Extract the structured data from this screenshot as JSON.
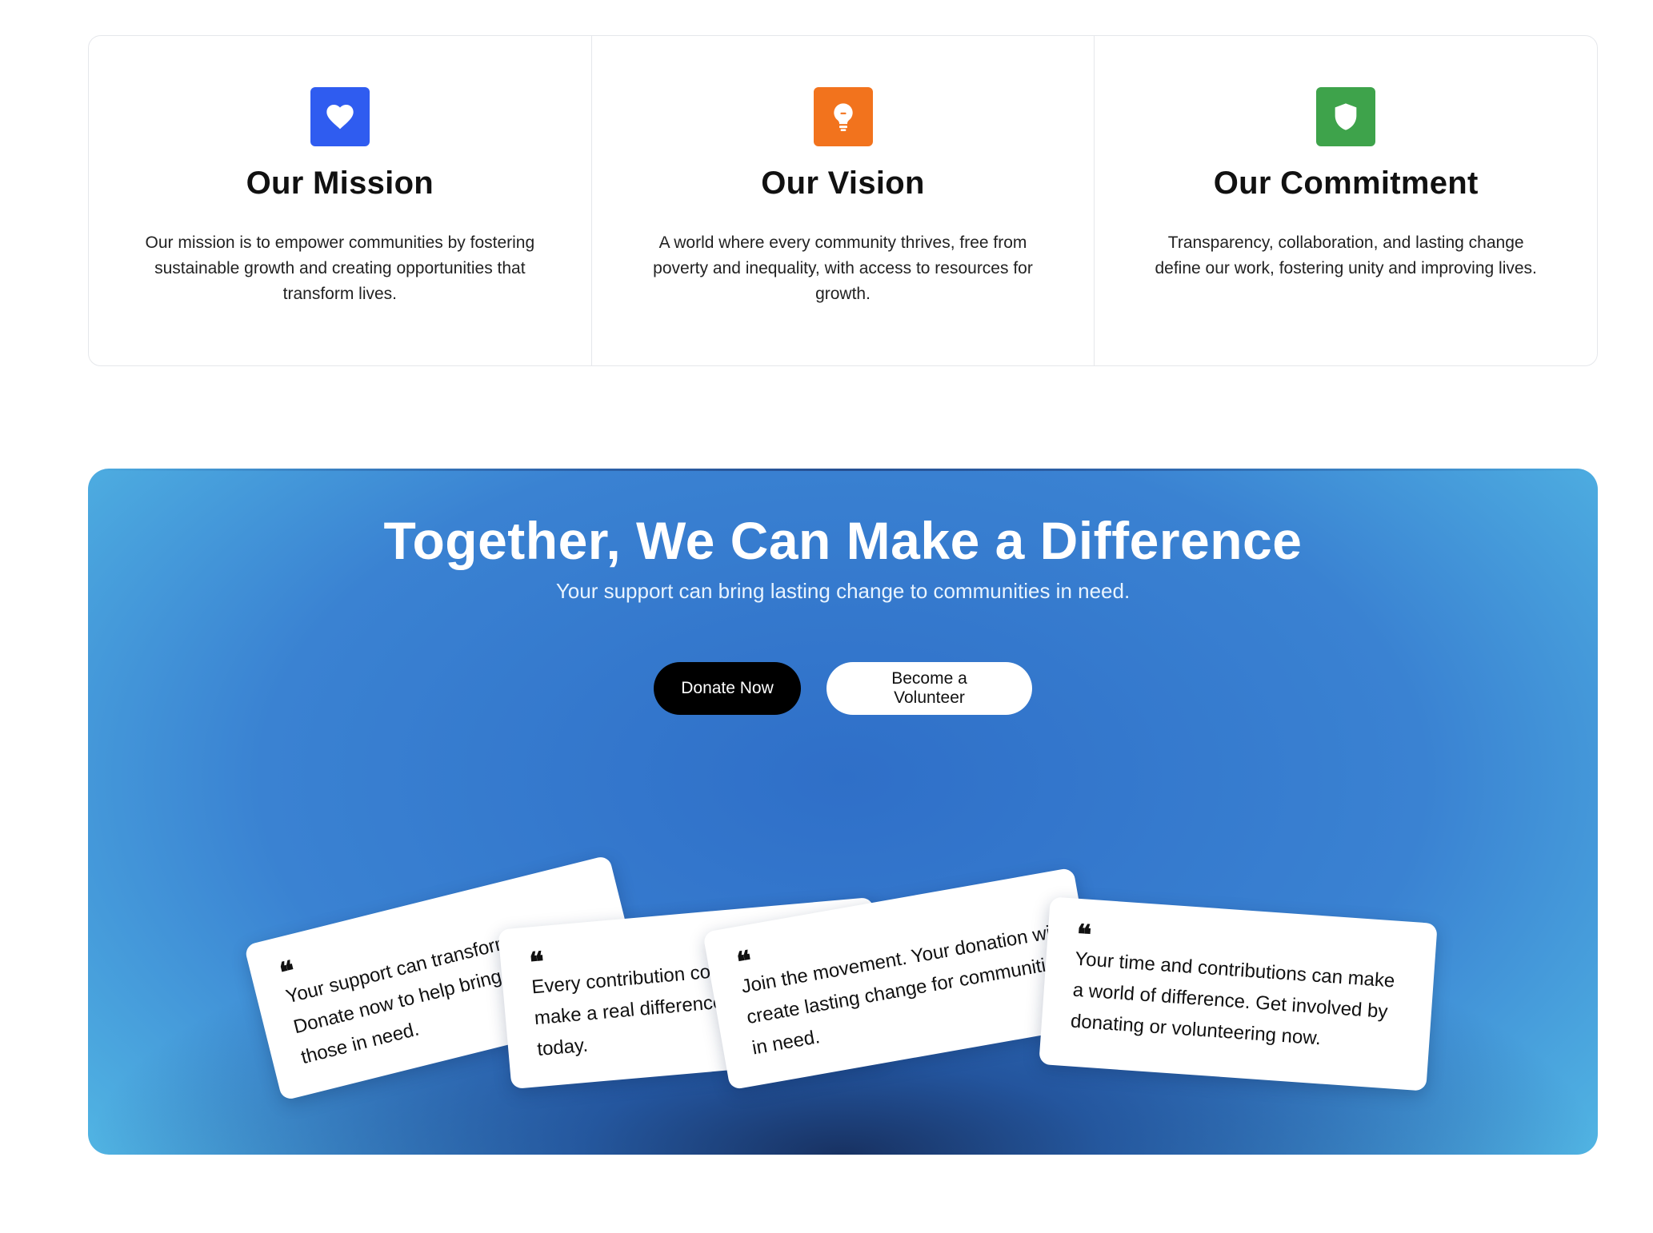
{
  "values": [
    {
      "title": "Our Mission",
      "text": "Our mission is to empower communities by fostering sustainable growth and creating opportunities that transform lives.",
      "icon": "heart-icon",
      "color": "#2f5cf0"
    },
    {
      "title": "Our Vision",
      "text": "A world where every community thrives, free from poverty and inequality, with access to resources for growth.",
      "icon": "lightbulb-icon",
      "color": "#f2731d"
    },
    {
      "title": "Our Commitment",
      "text": "Transparency, collaboration, and lasting change define our work, fostering unity and improving lives.",
      "icon": "shield-icon",
      "color": "#3ea34b"
    }
  ],
  "cta": {
    "title": "Together, We Can Make a Difference",
    "subtitle": "Your support can bring lasting change to communities in need.",
    "donate_label": "Donate Now",
    "volunteer_label": "Become a Volunteer"
  },
  "quote_mark": "❝",
  "testimonials": [
    {
      "lines": [
        "Your support can transform",
        "Donate now to help bring",
        "those in need."
      ]
    },
    {
      "lines": [
        "Every contribution counts",
        "make a real difference",
        "today."
      ]
    },
    {
      "lines": [
        "Join the movement. Your donation will",
        "create lasting change for communities",
        "in need."
      ]
    },
    {
      "lines": [
        "Your time and contributions can make",
        "a world of difference. Get involved by",
        "donating or volunteering now."
      ]
    }
  ]
}
